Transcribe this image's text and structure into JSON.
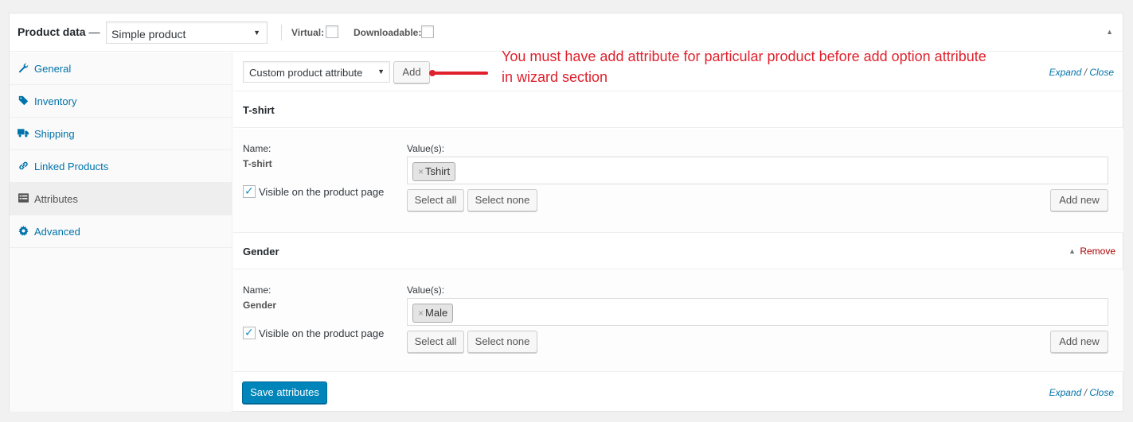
{
  "header": {
    "title": "Product data",
    "dash": "—",
    "product_type": "Simple product",
    "virtual_label": "Virtual:",
    "downloadable_label": "Downloadable:"
  },
  "tabs": [
    {
      "label": "General",
      "icon": "wrench-icon"
    },
    {
      "label": "Inventory",
      "icon": "tag-icon"
    },
    {
      "label": "Shipping",
      "icon": "truck-icon"
    },
    {
      "label": "Linked Products",
      "icon": "link-icon"
    },
    {
      "label": "Attributes",
      "icon": "list-icon",
      "active": true
    },
    {
      "label": "Advanced",
      "icon": "gear-icon"
    }
  ],
  "toolbar": {
    "attribute_select": "Custom product attribute",
    "add_label": "Add",
    "expand": "Expand",
    "separator": "/",
    "close": "Close"
  },
  "annotation": "You must have add attribute for particular product before add option attribute in wizard section",
  "attributes": [
    {
      "heading": "T-shirt",
      "name_label": "Name:",
      "name": "T-shirt",
      "values_label": "Value(s):",
      "value_chip": "Tshirt",
      "chip_remove": "×",
      "visible_label": "Visible on the product page",
      "select_all": "Select all",
      "select_none": "Select none",
      "add_new": "Add new"
    },
    {
      "heading": "Gender",
      "remove_label": "Remove",
      "name_label": "Name:",
      "name": "Gender",
      "values_label": "Value(s):",
      "value_chip": "Male",
      "chip_remove": "×",
      "visible_label": "Visible on the product page",
      "select_all": "Select all",
      "select_none": "Select none",
      "add_new": "Add new"
    }
  ],
  "footer": {
    "save_label": "Save attributes",
    "expand": "Expand",
    "separator": "/",
    "close": "Close"
  },
  "colors": {
    "accent": "#0073aa",
    "primary_button": "#0085ba",
    "annotation": "#e0212d",
    "remove": "#aa0000"
  }
}
